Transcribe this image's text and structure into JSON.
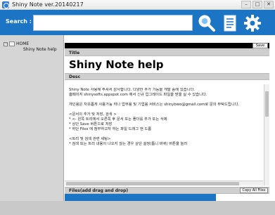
{
  "window": {
    "title": "Shiny Note   ver.20140217",
    "minimize": "–",
    "maximize": "□",
    "close": "✕"
  },
  "header": {
    "search_label": "Search :",
    "search_value": ""
  },
  "sidebar": {
    "root": "HOME",
    "child": "Shiny Note help"
  },
  "toolbar": {
    "save_label": "Save"
  },
  "sections": {
    "title_label": "Title",
    "title_value": "Shiny Note help",
    "desc_label": "Desc",
    "files_label": "Files(add drag and drop)",
    "copy_all_files_label": "Copy All Files"
  },
  "desc_lines": [
    "Shiny Note 사용해 주셔서 감사합니다. 다양한 추가 기능을 개발 중에 있습니다.",
    "홈페이지 shinysofts.appspot.com 에서 신규 업그레이드 파일을 받을 실 수 있습니다.",
    "",
    "개인용은 자유롭게 사용가능 하나 업무용 및 기업용 서비스는 shinybwo@gmail.com로 문의 부탁드립니다.",
    "",
    "<문서의 추가 및 저장, 검색 >",
    "* <- 왼쪽 트리에서 오른쪽 후 문서 또는 폴더를 추가 또는 삭제",
    "* 상단 Save 버튼으로 저장",
    "* 하단 Files 에 첨부하고자 하는 파일 드래그 앤 드롭",
    "",
    "<트리 및 검색 관련 세팅>",
    "* 검색 또는 트리 내용이 나오지 않는 경우 상단 설정(톱니 바퀴) 버튼을 눌러"
  ],
  "files_progress": 0.74,
  "colors": {
    "accent": "#1c74c4",
    "sidebar": "#d5d5d5",
    "section": "#cfcfcf"
  },
  "icons": [
    "search-icon",
    "document-icon",
    "settings-gear-icon",
    "home-icon"
  ]
}
